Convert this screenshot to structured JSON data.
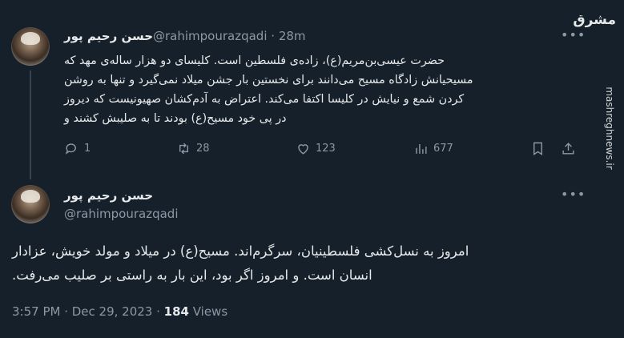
{
  "tweet1": {
    "name": "حسن رحیم پور",
    "handle": "@rahimpourazqadi",
    "separator": "·",
    "time": "28m",
    "lines": [
      "حضرت عیسی‌بن‌مریم(ع)، زاده‌ی فلسطین است. کلیسای دو هزار ساله‌ی مهد که",
      "مسیحیانش زادگاه مسیح می‌دانند برای نخستین بار جشن میلاد نمی‌گیرد و تنها به روشن",
      "کردن شمع و نیایش در کلیسا اکتفا می‌کند. اعتراض به آدم‌کشان صهیونیست که دیروز",
      "در پی خود مسیح(ع) بودند تا به صلیبش کشند و"
    ],
    "actions": {
      "replies": "1",
      "retweets": "28",
      "likes": "123",
      "views": "677"
    }
  },
  "tweet2": {
    "name": "حسن رحیم پور",
    "handle": "@rahimpourazqadi",
    "lines": [
      "امروز به نسل‌کشی فلسطینیان، سرگرم‌اند. مسیح(ع) در میلاد و مولد خویش، عزادار",
      "انسان است. و امروز اگر بود، این بار به راستی بر صلیب می‌رفت."
    ],
    "timestamp": "3:57 PM · Dec 29, 2023 · ",
    "views_count": "184",
    "views_label": " Views"
  },
  "watermark": {
    "logo": "مشرق",
    "url": "mashreghnews.ir"
  },
  "icons": {
    "reply": "speech-bubble-icon",
    "retweet": "retweet-arrows-icon",
    "like": "heart-icon",
    "views": "bar-chart-icon",
    "bookmark": "bookmark-icon",
    "share": "share-upload-icon",
    "more": "more-horizontal-icon"
  },
  "colors": {
    "background": "#15202b",
    "text": "#e7e9ea",
    "muted": "#8b98a5"
  }
}
